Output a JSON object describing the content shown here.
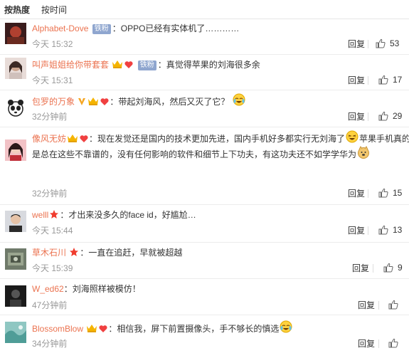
{
  "sort": {
    "hot": "按热度",
    "time": "按时间"
  },
  "reply_label": "回复",
  "comments": [
    {
      "user": "Alphabet-Dove",
      "badge": "铁粉",
      "sep": "：",
      "text": "OPPO已经有实体机了…………",
      "time": "今天 15:32",
      "likes": "53"
    },
    {
      "user": "叫声姐姐给你带套套",
      "badge": "铁粉",
      "sep": "：",
      "text": "真觉得苹果的刘海很多余",
      "time": "今天 15:31",
      "likes": "17"
    },
    {
      "user": "包罗的万象",
      "sep": "：",
      "text": "带起刘海风，然后又灭了它？",
      "time": "32分钟前",
      "likes": "29"
    },
    {
      "user": "像风无妨",
      "sep": "：",
      "text": "现在发觉还是国内的技术更加先进，国内手机好多都实行无刘海了",
      "text2": "苹果手机真的",
      "text3": "是总在这些不靠谱的，没有任何影响的软件和细节上下功夫，有这功夫还不如学学华为",
      "time": "32分钟前",
      "likes": "15"
    },
    {
      "user": "welll",
      "sep": "：",
      "text": "才出来没多久的face id，好尴尬…",
      "time": "今天 15:44",
      "likes": "13"
    },
    {
      "user": "草木石川",
      "sep": "：",
      "text": "一直在追赶，早就被超越",
      "time": "今天 15:39",
      "likes": "9"
    },
    {
      "user": "W_ed62",
      "sep": "：",
      "text": "刘海照样被模仿！",
      "time": "47分钟前",
      "likes": ""
    },
    {
      "user": "BlossomBlow",
      "sep": "：",
      "text": "相信我，屏下前置摄像头，手不够长的慎选",
      "time": "34分钟前",
      "likes": ""
    }
  ],
  "colors": {
    "username": "#eb7350",
    "time": "#999999",
    "badge": "#8fa6cf"
  }
}
